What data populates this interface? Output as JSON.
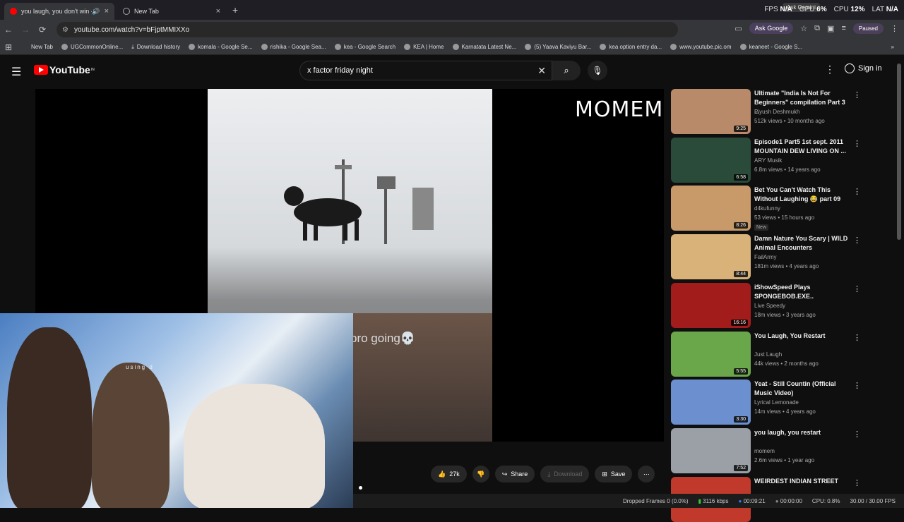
{
  "browser": {
    "tabs": [
      {
        "title": "you laugh, you don't win - Y",
        "active": true
      },
      {
        "title": "New Tab",
        "active": false
      }
    ],
    "perf": {
      "fps_label": "FPS",
      "fps": "N/A",
      "gpu_label": "GPU",
      "gpu": "6%",
      "cpu_label": "CPU",
      "cpu": "12%",
      "lat_label": "LAT",
      "lat": "N/A"
    },
    "ask_gemini_tip": "Ask Gemini",
    "url": "youtube.com/watch?v=bFjptMMIXXo",
    "ask_google": "Ask Google",
    "paused": "Paused",
    "bookmarks": [
      "New Tab",
      "UGCommonOnline...",
      "Download history",
      "komala - Google Se...",
      "rishika - Google Sea...",
      "kea - Google Search",
      "KEA | Home",
      "Karnatata Latest Ne...",
      "(5) Yaava Kaviyu Bar...",
      "kea option entry da...",
      "www.youtube.pic.om",
      "keaneet - Google S..."
    ]
  },
  "youtube": {
    "logo": "YouTube",
    "logo_region": "IN",
    "search_value": "x factor friday night",
    "sign_in": "Sign in",
    "overlay_text": "MOMEM",
    "caption": "bro going💀",
    "cam_text": "using d",
    "actions": {
      "likes": "27k",
      "share": "Share",
      "download": "Download",
      "save": "Save"
    },
    "recommendations": [
      {
        "title": "Ultimate \"India Is Not For Beginners\" compilation Part 3 ...",
        "channel": "Piyush Deshmukh",
        "meta": "512k views • 10 months ago",
        "duration": "9:25",
        "thumb": "#b98a6a"
      },
      {
        "title": "Episode1 Part5 1st sept. 2011 MOUNTAIN DEW LIVING ON ...",
        "channel": "ARY Musik",
        "meta": "6.8m views • 14 years ago",
        "duration": "6:58",
        "thumb": "#2b4b3a"
      },
      {
        "title": "Bet You Can't Watch This Without Laughing 😂 part 09",
        "channel": "d4kufunny",
        "meta": "53 views • 15 hours ago",
        "duration": "8:26",
        "badge": "New",
        "thumb": "#c89a6a"
      },
      {
        "title": "Damn Nature You Scary | WILD Animal Encounters",
        "channel": "FailArmy",
        "meta": "181m views • 4 years ago",
        "duration": "8:44",
        "thumb": "#d9b27a"
      },
      {
        "title": "iShowSpeed Plays SPONGEBOB.EXE..",
        "channel": "Live Speedy",
        "meta": "18m views • 3 years ago",
        "duration": "16:16",
        "thumb": "#a31c1c"
      },
      {
        "title": "You Laugh, You Restart",
        "channel": "Just Laugh",
        "meta": "44k views • 2 months ago",
        "duration": "5:55",
        "thumb": "#6aa64a"
      },
      {
        "title": "Yeat - Still Countin (Official Music Video)",
        "channel": "Lyrical Lemonade",
        "meta": "14m views • 4 years ago",
        "duration": "3:30",
        "thumb": "#6b8fcf"
      },
      {
        "title": "you laugh, you restart",
        "channel": "momem",
        "meta": "2.6m views • 1 year ago",
        "duration": "7:52",
        "thumb": "#9aa0a6"
      },
      {
        "title": "WEIRDEST INDIAN STREET",
        "channel": "",
        "meta": "",
        "duration": "",
        "thumb": "#c0392b"
      }
    ]
  },
  "status": {
    "dropped": "Dropped Frames 0 (0.0%)",
    "bitrate": "3116 kbps",
    "time1": "00:09:21",
    "time2": "00:00:00",
    "cpu": "CPU: 0.8%",
    "fps": "30.00 / 30.00 FPS"
  }
}
